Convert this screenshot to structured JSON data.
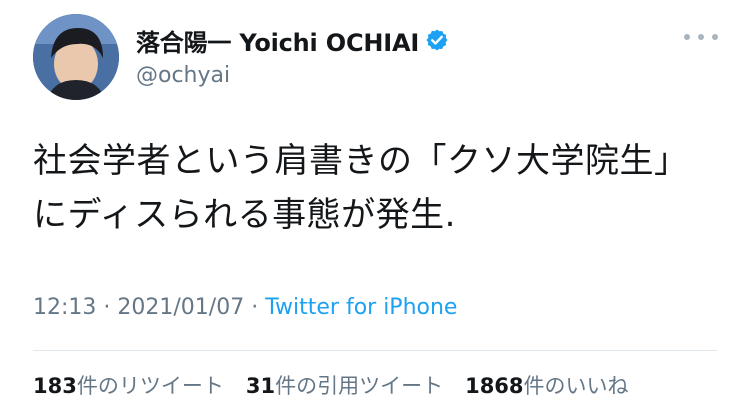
{
  "author": {
    "display_name": "落合陽一 Yoichi OCHIAI",
    "handle": "@ochyai",
    "verified": true,
    "avatar_icon": "avatar-icon"
  },
  "tweet": {
    "text": "社会学者という肩書きの「クソ大学院生」にディスられる事態が発生.",
    "time": "12:13",
    "separator": "·",
    "date": "2021/01/07",
    "source": "Twitter for iPhone"
  },
  "stats": {
    "retweets_count": "183",
    "retweets_label": "件のリツイート",
    "quotes_count": "31",
    "quotes_label": "件の引用ツイート",
    "likes_count": "1868",
    "likes_label": "件のいいね"
  },
  "colors": {
    "text": "#14171a",
    "secondary": "#657786",
    "link": "#1da1f2",
    "verified_badge": "#1da1f2"
  }
}
